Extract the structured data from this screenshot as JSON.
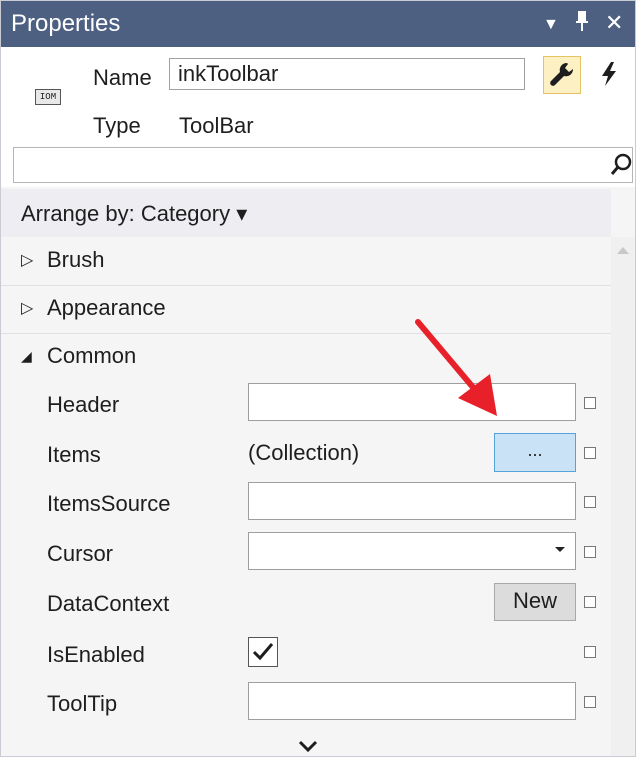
{
  "window": {
    "title": "Properties",
    "controls": {
      "dropdown": "▾",
      "pin": "ᵖ",
      "close": "✕"
    }
  },
  "header": {
    "name_label": "Name",
    "name_value": "inkToolbar",
    "type_label": "Type",
    "type_value": "ToolBar",
    "object_icon_text": "IOM"
  },
  "search": {
    "placeholder": ""
  },
  "arrange": {
    "label": "Arrange by: Category ▾"
  },
  "categories": {
    "brush": {
      "arrow": "▷",
      "label": "Brush"
    },
    "appearance": {
      "arrow": "▷",
      "label": "Appearance"
    },
    "common": {
      "arrow": "◢",
      "label": "Common"
    }
  },
  "properties": {
    "header": {
      "label": "Header",
      "value": ""
    },
    "items": {
      "label": "Items",
      "value": "(Collection)",
      "button": "..."
    },
    "items_source": {
      "label": "ItemsSource",
      "value": ""
    },
    "cursor": {
      "label": "Cursor",
      "value": ""
    },
    "data_context": {
      "label": "DataContext",
      "button": "New"
    },
    "is_enabled": {
      "label": "IsEnabled",
      "checked": true
    },
    "tooltip": {
      "label": "ToolTip",
      "value": ""
    }
  },
  "colors": {
    "titlebar": "#4d6082",
    "wrench_active_bg": "#fdf0c2",
    "dots_button_bg": "#c9e2f6",
    "annotation_arrow": "#e8202a"
  },
  "icons": [
    "object-type-icon",
    "wrench-icon",
    "lightning-icon",
    "search-icon",
    "chevron-down-icon",
    "red-arrow-annotation"
  ]
}
